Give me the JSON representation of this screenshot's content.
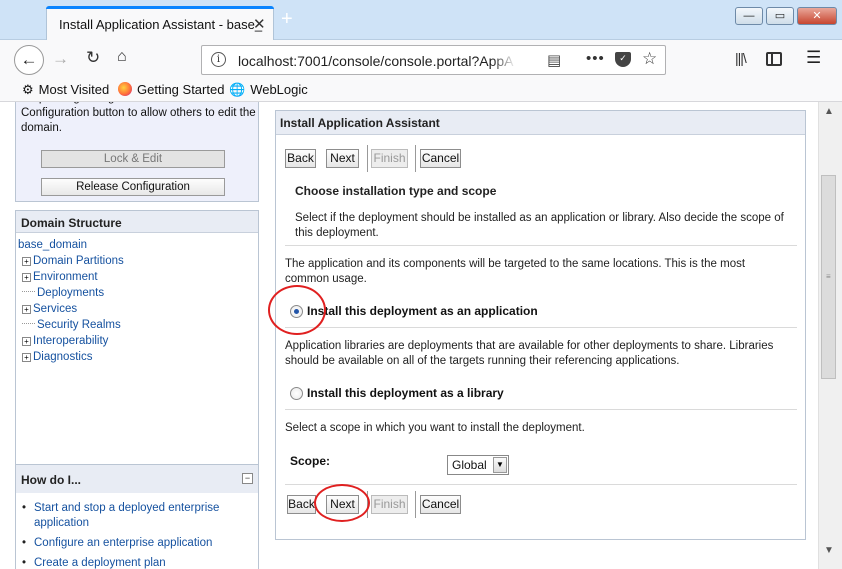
{
  "browser": {
    "tab_title": "Install Application Assistant - base_",
    "tab_close": "✕",
    "new_tab": "+",
    "url": "localhost:7001/console/console.portal?AppA",
    "bookmarks": [
      {
        "label": "Most Visited"
      },
      {
        "label": "Getting Started"
      },
      {
        "label": "WebLogic"
      }
    ],
    "window_buttons": {
      "minimize": "—",
      "maximize": "▭",
      "close": "✕"
    }
  },
  "sidebar": {
    "change_center_text": "No pending changes exist. Click the Release Configuration button to allow others to edit the domain.",
    "lock_edit_label": "Lock & Edit",
    "release_config_label": "Release Configuration",
    "domain_structure": {
      "title": "Domain Structure",
      "root": "base_domain",
      "items": [
        {
          "label": "Domain Partitions",
          "expandable": true
        },
        {
          "label": "Environment",
          "expandable": true
        },
        {
          "label": "Deployments",
          "expandable": false
        },
        {
          "label": "Services",
          "expandable": true
        },
        {
          "label": "Security Realms",
          "expandable": false
        },
        {
          "label": "Interoperability",
          "expandable": true
        },
        {
          "label": "Diagnostics",
          "expandable": true
        }
      ]
    },
    "how_do_i": {
      "title": "How do I...",
      "collapse": "−",
      "items": [
        {
          "label": "Start and stop a deployed enterprise application"
        },
        {
          "label": "Configure an enterprise application"
        },
        {
          "label": "Create a deployment plan"
        }
      ]
    }
  },
  "assistant": {
    "title": "Install Application Assistant",
    "buttons": {
      "back": "Back",
      "next": "Next",
      "finish": "Finish",
      "cancel": "Cancel"
    },
    "heading": "Choose installation type and scope",
    "intro": "Select if the deployment should be installed as an application or library. Also decide the scope of this deployment.",
    "app_description": "The application and its components will be targeted to the same locations. This is the most common usage.",
    "option_application": "Install this deployment as an application",
    "lib_description": "Application libraries are deployments that are available for other deployments to share. Libraries should be available on all of the targets running their referencing applications.",
    "option_library": "Install this deployment as a library",
    "scope_description": "Select a scope in which you want to install the deployment.",
    "scope_label": "Scope:",
    "scope_value": "Global",
    "selected_option": "application"
  },
  "colors": {
    "link": "#15519f",
    "highlight_ring": "#e02020",
    "panel_header": "#e8ecf4",
    "change_center_bg": "#eef0fb",
    "tab_accent": "#0a84ff"
  }
}
